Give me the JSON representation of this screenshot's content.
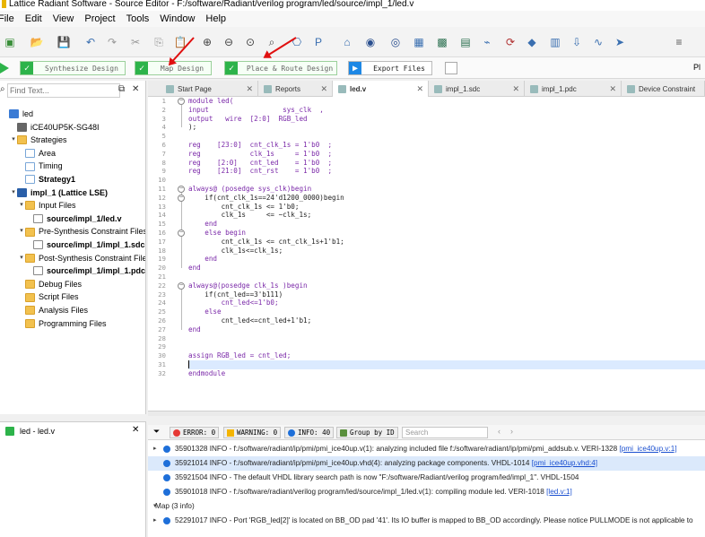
{
  "window": {
    "title": "Lattice Radiant Software - Source Editor - F:/software/Radiant/verilog program/led/source/impl_1/led.v"
  },
  "menu": [
    "File",
    "Edit",
    "View",
    "Project",
    "Tools",
    "Window",
    "Help"
  ],
  "toolbar": {
    "icons": [
      "new-icon",
      "open-folder-icon",
      "save-icon",
      "undo-icon",
      "redo-icon",
      "cut-icon",
      "copy-icon",
      "paste-icon",
      "zoom-in-icon",
      "zoom-out-icon",
      "zoom-fit-icon",
      "zoom-area-icon",
      "ip-catalog-icon",
      "ip-icon",
      "home-icon",
      "netlist-icon",
      "device-constraint-icon",
      "floorplan-icon",
      "physical-view-icon",
      "chip-icon",
      "timing-icon",
      "power-icon",
      "reveal-icon",
      "program-icon",
      "download-icon",
      "simulation-icon",
      "arrow-icon",
      "pl-icon"
    ]
  },
  "flow": {
    "steps": [
      {
        "label": "Synthesize Design",
        "status": "done"
      },
      {
        "label": "Map Design",
        "status": "done"
      },
      {
        "label": "Place & Route Design",
        "status": "done"
      },
      {
        "label": "Export Files",
        "status": "pending"
      }
    ],
    "right_label": "Pl"
  },
  "left_panel": {
    "search_placeholder": "Find Text...",
    "tree": [
      {
        "label": "led",
        "depth": 0,
        "icon": "proj",
        "exp": ""
      },
      {
        "label": "iCE40UP5K-SG48I",
        "depth": 1,
        "icon": "chip",
        "exp": ""
      },
      {
        "label": "Strategies",
        "depth": 1,
        "icon": "folder",
        "exp": "▾"
      },
      {
        "label": "Area",
        "depth": 2,
        "icon": "doc",
        "exp": ""
      },
      {
        "label": "Timing",
        "depth": 2,
        "icon": "doc",
        "exp": ""
      },
      {
        "label": "Strategy1",
        "depth": 2,
        "icon": "doc",
        "exp": "",
        "bold": true
      },
      {
        "label": "impl_1 (Lattice LSE)",
        "depth": 1,
        "icon": "impl",
        "exp": "▾",
        "bold": true
      },
      {
        "label": "Input Files",
        "depth": 2,
        "icon": "folder",
        "exp": "▾"
      },
      {
        "label": "source/impl_1/led.v",
        "depth": 3,
        "icon": "file",
        "exp": "",
        "bold": true
      },
      {
        "label": "Pre-Synthesis Constraint Files",
        "depth": 2,
        "icon": "folder",
        "exp": "▾"
      },
      {
        "label": "source/impl_1/impl_1.sdc",
        "depth": 3,
        "icon": "file",
        "exp": "",
        "bold": true
      },
      {
        "label": "Post-Synthesis Constraint Files",
        "depth": 2,
        "icon": "folder",
        "exp": "▾"
      },
      {
        "label": "source/impl_1/impl_1.pdc",
        "depth": 3,
        "icon": "file",
        "exp": "",
        "bold": true
      },
      {
        "label": "Debug Files",
        "depth": 2,
        "icon": "folder",
        "exp": ""
      },
      {
        "label": "Script Files",
        "depth": 2,
        "icon": "folder",
        "exp": ""
      },
      {
        "label": "Analysis Files",
        "depth": 2,
        "icon": "folder",
        "exp": ""
      },
      {
        "label": "Programming Files",
        "depth": 2,
        "icon": "folder",
        "exp": ""
      }
    ]
  },
  "hierarchy": {
    "item": "led - led.v"
  },
  "tabs": [
    {
      "label": "Start Page",
      "active": false
    },
    {
      "label": "Reports",
      "active": false
    },
    {
      "label": "led.v",
      "active": true
    },
    {
      "label": "impl_1.sdc",
      "active": false
    },
    {
      "label": "impl_1.pdc",
      "active": false
    },
    {
      "label": "Device Constraint",
      "active": false
    }
  ],
  "editor": {
    "lines": [
      "module led(",
      "input                  sys_clk  ,",
      "output   wire  [2:0]  RGB_led",
      ");",
      "",
      "reg    [23:0]  cnt_clk_1s = 1'b0  ;",
      "reg            clk_1s     = 1'b0  ;",
      "reg    [2:0]   cnt_led    = 1'b0  ;",
      "reg    [21:0]  cnt_rst    = 1'b0  ;",
      "",
      "always@ (posedge sys_clk)begin",
      "    if(cnt_clk_1s==24'd1200_0000)begin",
      "        cnt_clk_1s <= 1'b0;",
      "        clk_1s     <= ~clk_1s;",
      "    end",
      "    else begin",
      "        cnt_clk_1s <= cnt_clk_1s+1'b1;",
      "        clk_1s<=clk_1s;",
      "    end",
      "end",
      "",
      "always@(posedge clk_1s )begin",
      "    if(cnt_led==3'b111)",
      "        cnt_led<=1'b0;",
      "    else",
      "        cnt_led<=cnt_led+1'b1;",
      "end",
      "",
      "",
      "assign RGB_led = cnt_led;",
      "",
      "endmodule"
    ],
    "current_line": 31
  },
  "output_bar": {
    "error": "ERROR: 0",
    "warning": "WARNING: 0",
    "info": "INFO: 40",
    "group": "Group by ID",
    "search_placeholder": "Search"
  },
  "output": [
    {
      "text": "35901328 INFO - f:/software/radiant/ip/pmi/pmi_ice40up.v(1): analyzing included file f:/software/radiant/ip/pmi/pmi_addsub.v. VERI-1328 ",
      "link": "[pmi_ice40up.v:1]",
      "exp": "▸"
    },
    {
      "text": "35921014 INFO - f:/software/radiant/ip/pmi/pmi_ice40up.vhd(4): analyzing package components. VHDL-1014 ",
      "link": "[pmi_ice40up.vhd:4]",
      "exp": "",
      "selected": true
    },
    {
      "text": "35921504 INFO - The default VHDL library search path is now \"F:/software/Radiant/verilog program/led/impl_1\". VHDL-1504",
      "link": "",
      "exp": ""
    },
    {
      "text": "35901018 INFO - f:/software/radiant/verilog program/led/source/impl_1/led.v(1): compiling module led. VERI-1018 ",
      "link": "[led.v:1]",
      "exp": ""
    },
    {
      "text": "Map (3 info)",
      "link": "",
      "exp": "▾",
      "group": true
    },
    {
      "text": "52291017 INFO - Port 'RGB_led[2]' is located on BB_OD pad '41'. Its IO buffer is mapped to BB_OD accordingly. Please notice PULLMODE is not applicable to",
      "link": "",
      "exp": "▸"
    }
  ],
  "colors": {
    "accent": "#2db34a",
    "link": "#1a4fd0",
    "keyword": "#7a28a8",
    "annotation_arrow": "#e01010"
  }
}
